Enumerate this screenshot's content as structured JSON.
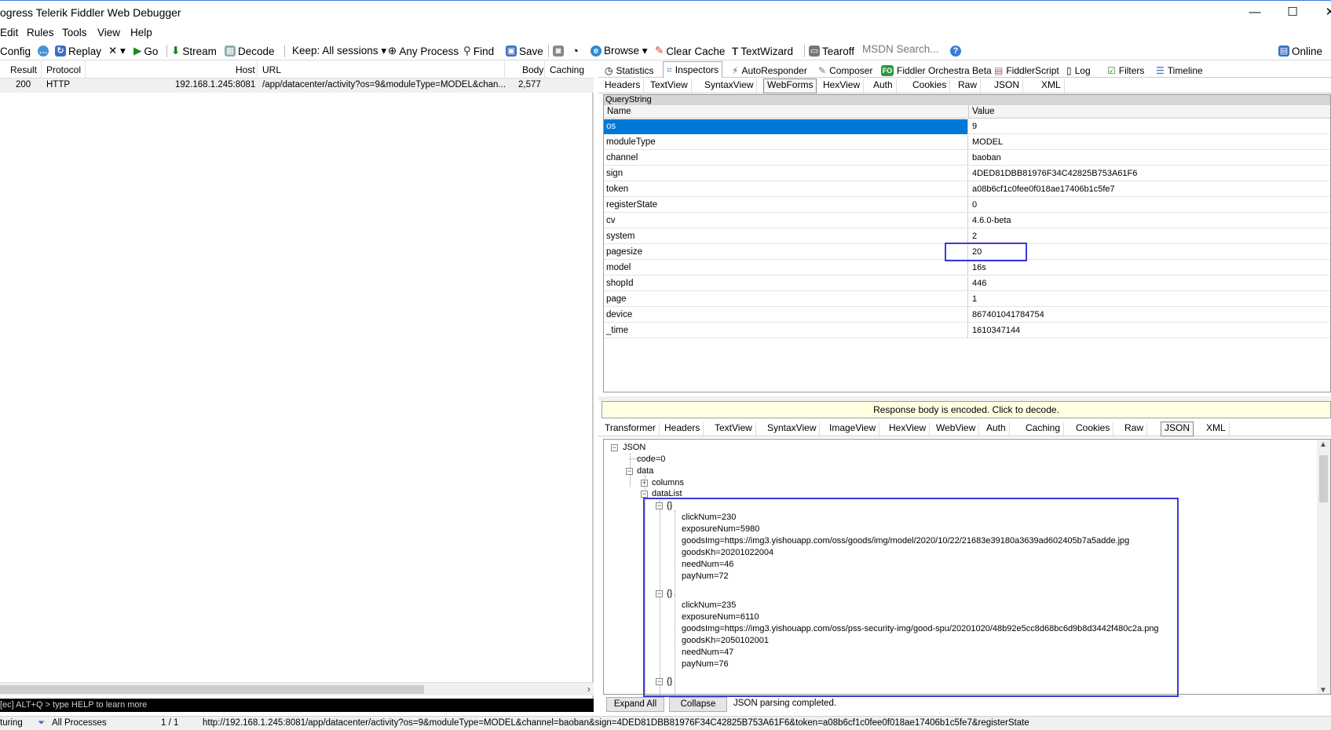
{
  "window": {
    "title": "ogress Telerik Fiddler Web Debugger",
    "minimize": "—",
    "maximize": "☐",
    "close": "✕"
  },
  "menu": [
    "Edit",
    "Rules",
    "Tools",
    "View",
    "Help"
  ],
  "toolbar": {
    "config": "Config",
    "replay": "Replay",
    "remove": "✕ ▾",
    "go": "Go",
    "stream": "Stream",
    "decode": "Decode",
    "keep": "Keep: All sessions ▾",
    "any_process": "Any Process",
    "find": "Find",
    "save": "Save",
    "browse": "Browse ▾",
    "clear_cache": "Clear Cache",
    "textwizard": "TextWizard",
    "tearoff": "Tearoff",
    "search_placeholder": "MSDN Search...",
    "online": "Online"
  },
  "sessions": {
    "columns": [
      "Result",
      "Protocol",
      "Host",
      "URL",
      "Body",
      "Caching"
    ],
    "rows": [
      {
        "result": "200",
        "protocol": "HTTP",
        "host": "192.168.1.245:8081",
        "url": "/app/datacenter/activity?os=9&moduleType=MODEL&chan...",
        "body": "2,577",
        "caching": ""
      }
    ]
  },
  "quickexec": "[ec] ALT+Q > type HELP to learn more",
  "statusbar": {
    "capturing": "turing",
    "processes": "All Processes",
    "count": "1 / 1",
    "url": "http://192.168.1.245:8081/app/datacenter/activity?os=9&moduleType=MODEL&channel=baoban&sign=4DED81DBB81976F34C42825B753A61F6&token=a08b6cf1c0fee0f018ae17406b1c5fe7&registerState"
  },
  "inspector_tabs": [
    "Statistics",
    "Inspectors",
    "AutoResponder",
    "Composer",
    "Fiddler Orchestra Beta",
    "FiddlerScript",
    "Log",
    "Filters",
    "Timeline"
  ],
  "request_tabs": [
    "Headers",
    "TextView",
    "SyntaxView",
    "WebForms",
    "HexView",
    "Auth",
    "Cookies",
    "Raw",
    "JSON",
    "XML"
  ],
  "querystring": {
    "caption": "QueryString",
    "name_header": "Name",
    "value_header": "Value",
    "rows": [
      {
        "name": "os",
        "value": "9"
      },
      {
        "name": "moduleType",
        "value": "MODEL"
      },
      {
        "name": "channel",
        "value": "baoban"
      },
      {
        "name": "sign",
        "value": "4DED81DBB81976F34C42825B753A61F6"
      },
      {
        "name": "token",
        "value": "a08b6cf1c0fee0f018ae17406b1c5fe7"
      },
      {
        "name": "registerState",
        "value": "0"
      },
      {
        "name": "cv",
        "value": "4.6.0-beta"
      },
      {
        "name": "system",
        "value": "2"
      },
      {
        "name": "pagesize",
        "value": "20"
      },
      {
        "name": "model",
        "value": "16s"
      },
      {
        "name": "shopId",
        "value": "446"
      },
      {
        "name": "page",
        "value": "1"
      },
      {
        "name": "device",
        "value": "867401041784754"
      },
      {
        "name": "_time",
        "value": "1610347144"
      }
    ]
  },
  "encoded_notice": "Response body is encoded. Click to decode.",
  "response_tabs": [
    "Transformer",
    "Headers",
    "TextView",
    "SyntaxView",
    "ImageView",
    "HexView",
    "WebView",
    "Auth",
    "Caching",
    "Cookies",
    "Raw",
    "JSON",
    "XML"
  ],
  "json_tree": {
    "root": "JSON",
    "code": "code=0",
    "data": "data",
    "columns": "columns",
    "datalist": "dataList",
    "obj": "{}",
    "item1": [
      "clickNum=230",
      "exposureNum=5980",
      "goodsImg=https://img3.yishouapp.com/oss/goods/img/model/2020/10/22/21683e39180a3639ad602405b7a5adde.jpg",
      "goodsKh=20201022004",
      "needNum=46",
      "payNum=72"
    ],
    "item2": [
      "clickNum=235",
      "exposureNum=6110",
      "goodsImg=https://img3.yishouapp.com/oss/pss-security-img/good-spu/20201020/48b92e5cc8d68bc6d9b8d3442f480c2a.png",
      "goodsKh=2050102001",
      "needNum=47",
      "payNum=76"
    ]
  },
  "json_footer": {
    "expand_all": "Expand All",
    "collapse": "Collapse",
    "status": "JSON parsing completed."
  }
}
